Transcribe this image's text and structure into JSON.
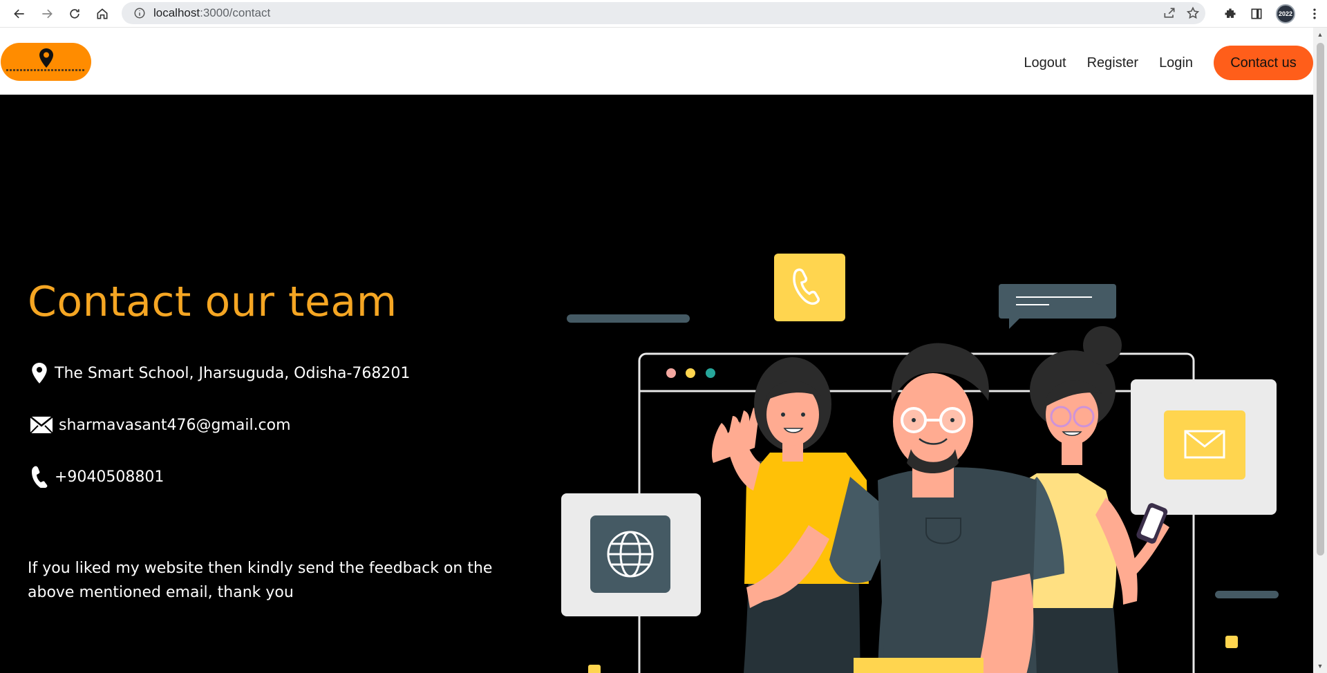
{
  "browser": {
    "url_host": "localhost",
    "url_path": ":3000/contact",
    "profile_label": "2022"
  },
  "navbar": {
    "links": [
      "Logout",
      "Register",
      "Login"
    ],
    "contact_button": "Contact us"
  },
  "contact": {
    "title": "Contact our team",
    "address": "The Smart School, Jharsuguda, Odisha-768201",
    "email": "sharmavasant476@gmail.com",
    "phone": "+9040508801",
    "feedback": "If you liked my website then kindly send the feedback on the above mentioned email, thank you"
  },
  "colors": {
    "accent_orange": "#ff8c00",
    "contact_button": "#ff5e1a",
    "title": "#f5a623",
    "page_bg": "#000000",
    "card_yellow": "#ffd54f",
    "dark_slate": "#455a64"
  },
  "icons": {
    "address": "location-pin-icon",
    "email": "envelope-icon",
    "phone": "phone-icon"
  }
}
